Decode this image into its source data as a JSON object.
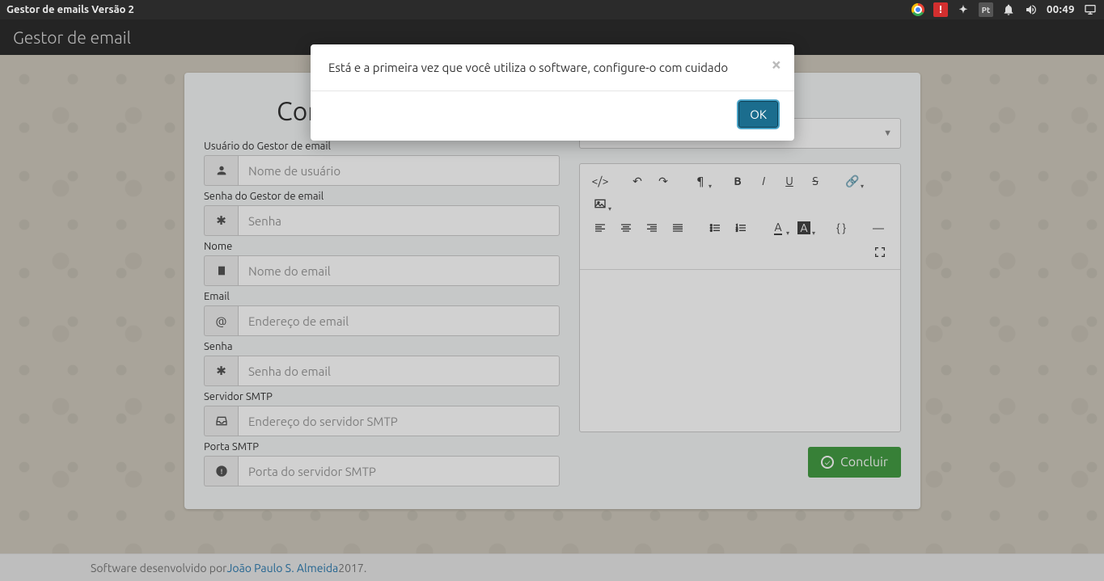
{
  "topbar": {
    "title": "Gestor de emails Versão 2",
    "lang_badge": "Pt",
    "time": "00:49"
  },
  "header": {
    "title": "Gestor de email"
  },
  "card": {
    "title_visible": "Conf"
  },
  "fields": {
    "usuario": {
      "label": "Usuário do Gestor de email",
      "placeholder": "Nome de usuário"
    },
    "senha_gestor": {
      "label": "Senha do Gestor de email",
      "placeholder": "Senha"
    },
    "nome": {
      "label": "Nome",
      "placeholder": "Nome do email"
    },
    "email": {
      "label": "Email",
      "placeholder": "Endereço de email"
    },
    "senha": {
      "label": "Senha",
      "placeholder": "Senha do email"
    },
    "servidor": {
      "label": "Servidor SMTP",
      "placeholder": "Endereço do servidor SMTP"
    },
    "porta": {
      "label": "Porta SMTP",
      "placeholder": "Porta do servidor SMTP"
    }
  },
  "buttons": {
    "concluir": "Concluir",
    "ok": "OK"
  },
  "modal": {
    "text": "Está e a primeira vez que você utiliza o software, configure-o com cuidado"
  },
  "footer": {
    "prefix": "Software desenvolvido por ",
    "author": "João Paulo S. Almeida",
    "suffix": " 2017."
  }
}
